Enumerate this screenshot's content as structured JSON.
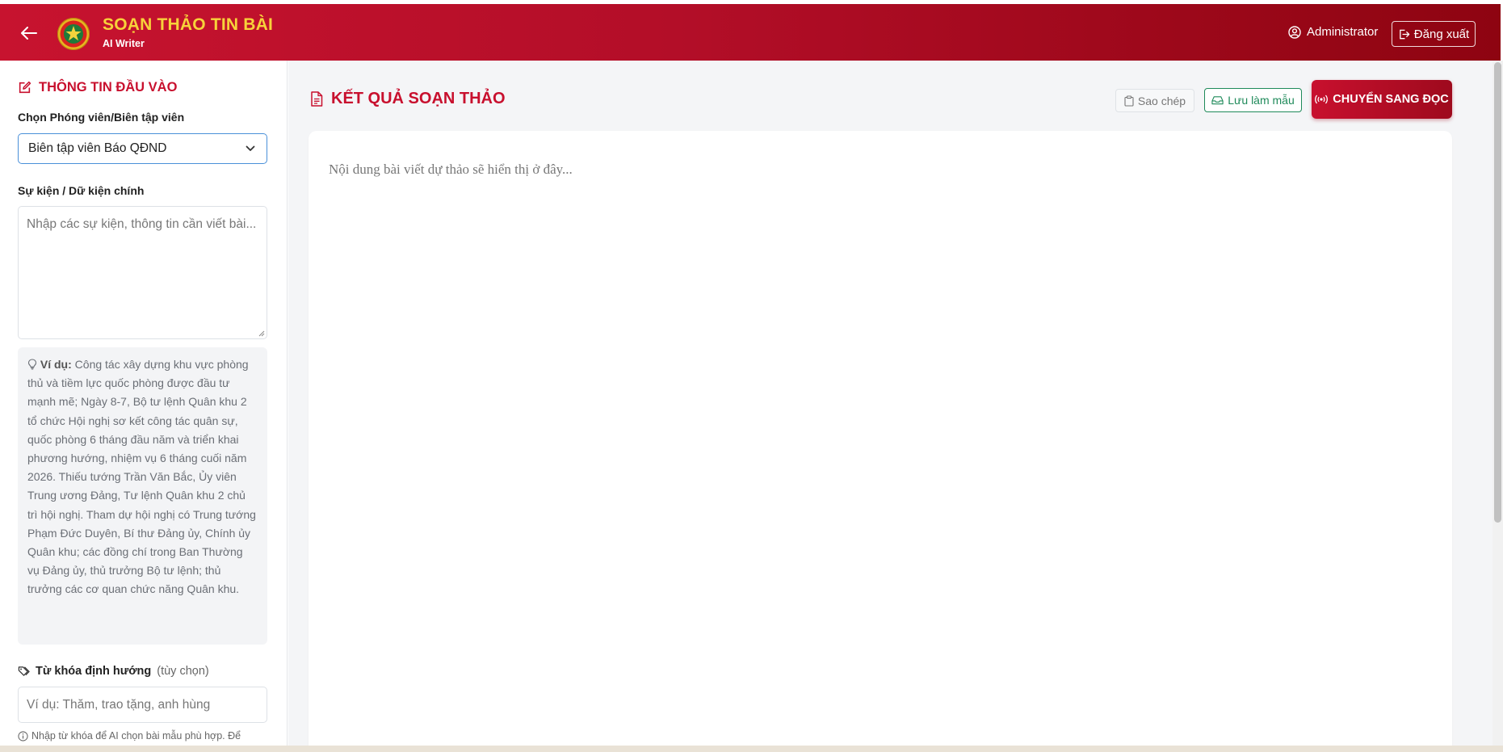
{
  "header": {
    "title": "SOẠN THẢO TIN BÀI",
    "subtitle": "AI Writer",
    "user_name": "Administrator",
    "logout_label": "Đăng xuất"
  },
  "input_panel": {
    "section_title": "THÔNG TIN ĐẦU VÀO",
    "reporter_label": "Chọn Phóng viên/Biên tập viên",
    "reporter_selected": "Biên tập viên Báo QĐND",
    "facts_label": "Sự kiện / Dữ kiện chính",
    "facts_placeholder": "Nhập các sự kiện, thông tin cần viết bài...",
    "example_prefix": "Ví dụ:",
    "example_text": "Công tác xây dựng khu vực phòng thủ và tiềm lực quốc phòng được đầu tư mạnh mẽ; Ngày 8-7, Bộ tư lệnh Quân khu 2 tổ chức Hội nghị sơ kết công tác quân sự, quốc phòng 6 tháng đầu năm và triển khai phương hướng, nhiệm vụ 6 tháng cuối năm 2026. Thiếu tướng Trần Văn Bắc, Ủy viên Trung ương Đảng, Tư lệnh Quân khu 2 chủ trì hội nghị. Tham dự hội nghị có Trung tướng Phạm Đức Duyên, Bí thư Đảng ủy, Chính ủy Quân khu; các đồng chí trong Ban Thường vụ Đảng ủy, thủ trưởng Bộ tư lệnh; thủ trưởng các cơ quan chức năng Quân khu.",
    "keywords_label": "Từ khóa định hướng",
    "keywords_optional": "(tùy chọn)",
    "keywords_placeholder": "Ví dụ: Thăm, trao tặng, anh hùng",
    "keywords_hint": "Nhập từ khóa để AI chọn bài mẫu phù hợp. Để"
  },
  "result_panel": {
    "section_title": "KẾT QUẢ SOẠN THẢO",
    "copy_label": "Sao chép",
    "save_template_label": "Lưu làm mẫu",
    "switch_label": "CHUYỂN SANG ĐỌC",
    "editor_placeholder": "Nội dung bài viết dự thảo sẽ hiển thị ở đây..."
  },
  "colors": {
    "brand_red": "#c8102e",
    "brand_dark_red": "#8e0411",
    "title_gold": "#f7d23a",
    "save_green": "#1f8a5a"
  },
  "icons": {
    "back": "arrow-left-icon",
    "logo": "emblem-logo",
    "user": "user-circle-icon",
    "logout": "logout-icon",
    "edit": "edit-square-icon",
    "chevron": "chevron-down-icon",
    "bulb": "lightbulb-icon",
    "tag": "tags-icon",
    "info": "info-circle-icon",
    "document": "document-text-icon",
    "clipboard": "clipboard-icon",
    "save": "inbox-save-icon",
    "broadcast": "broadcast-icon"
  }
}
